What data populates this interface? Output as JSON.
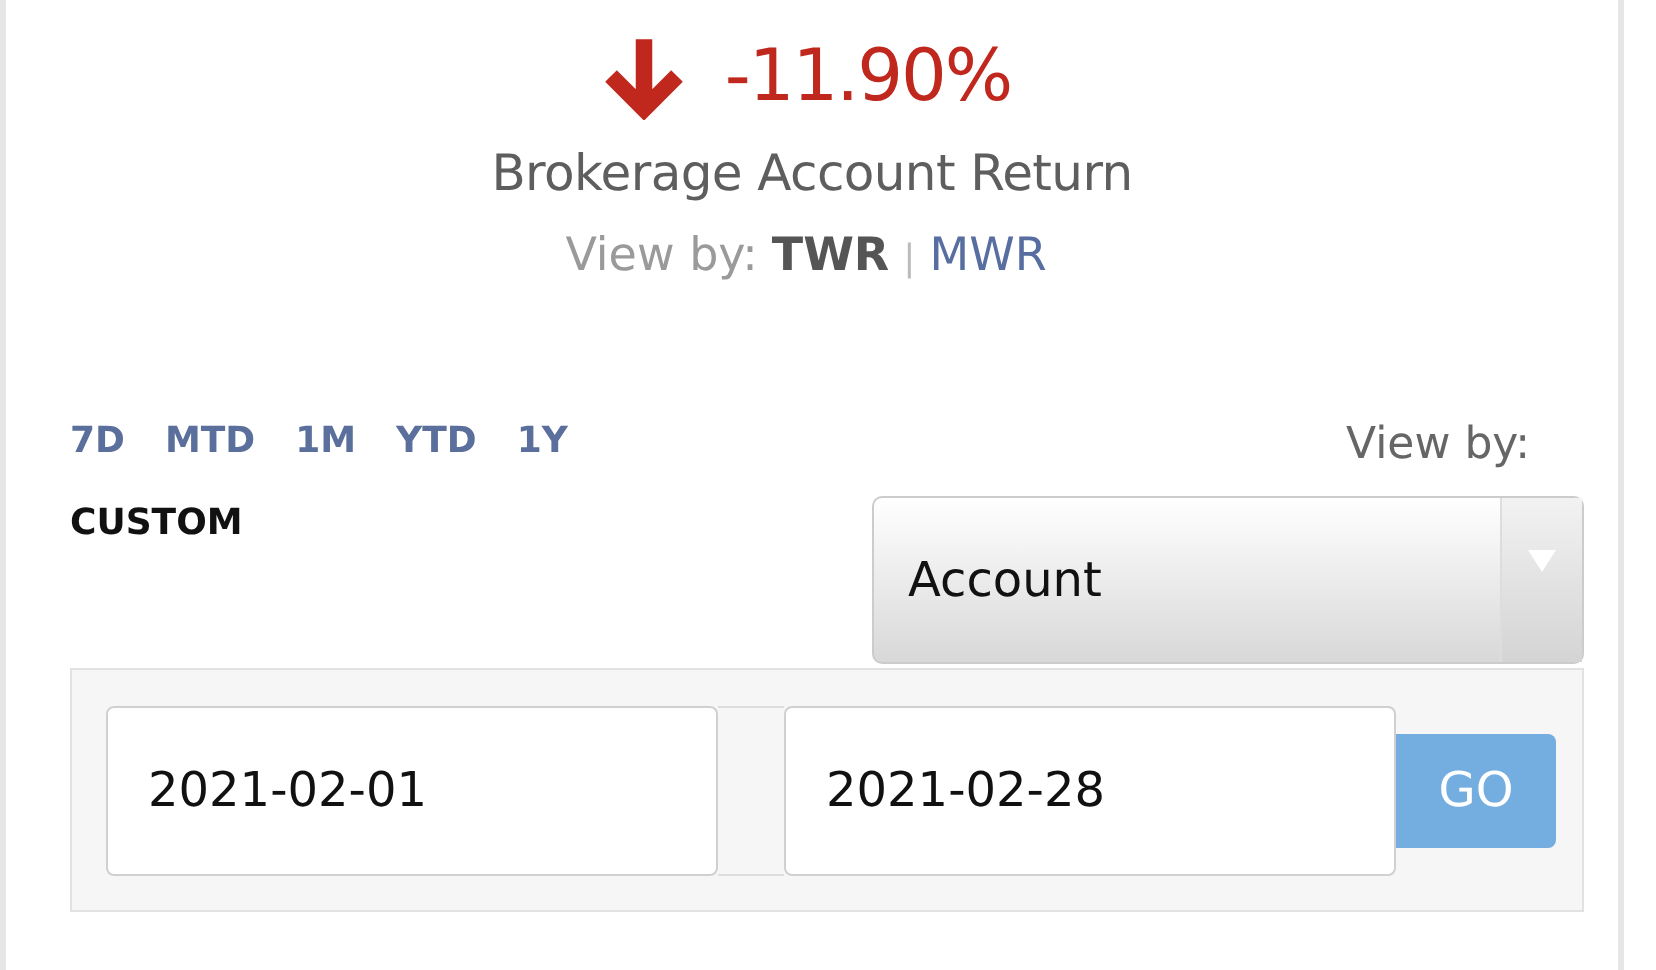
{
  "summary": {
    "falling": true,
    "value": "-11.90%",
    "label": "Brokerage Account Return",
    "view_by_label": "View by:",
    "separator": "|",
    "methods": [
      {
        "label": "TWR",
        "selected": true
      },
      {
        "label": "MWR",
        "selected": false
      }
    ]
  },
  "periods": [
    {
      "label": "7D",
      "selected": false
    },
    {
      "label": "MTD",
      "selected": false
    },
    {
      "label": "1M",
      "selected": false
    },
    {
      "label": "YTD",
      "selected": false
    },
    {
      "label": "1Y",
      "selected": false
    },
    {
      "label": "CUSTOM",
      "selected": true
    }
  ],
  "view_by": {
    "label": "View by:",
    "value": "Account"
  },
  "date_range": {
    "start": "2021-02-01",
    "end": "2021-02-28",
    "button": "GO"
  }
}
